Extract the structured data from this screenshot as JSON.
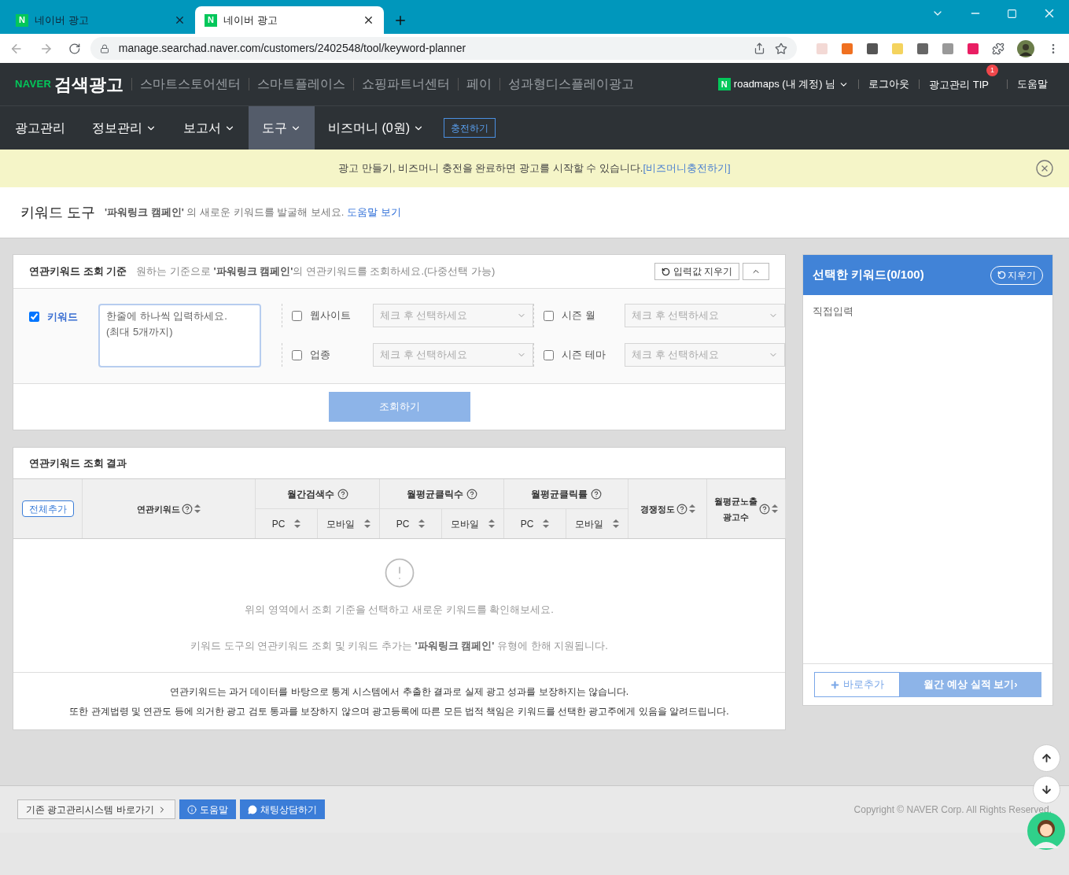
{
  "browser": {
    "tabs": [
      {
        "icon_letter": "N",
        "title": "네이버 광고",
        "selected": false
      },
      {
        "icon_letter": "N",
        "title": "네이버 광고",
        "selected": true
      }
    ],
    "url": "manage.searchad.naver.com/customers/2402548/tool/keyword-planner"
  },
  "header": {
    "logo": "NAVER",
    "product": "검색광고",
    "links": [
      "스마트스토어센터",
      "스마트플레이스",
      "쇼핑파트너센터",
      "페이",
      "성과형디스플레이광고"
    ],
    "user_badge": "N",
    "user": "roadmaps (내 계정) 님",
    "logout": "로그아웃",
    "tip": "광고관리 TIP",
    "tip_badge": "1",
    "help": "도움말"
  },
  "nav": {
    "items": [
      {
        "label": "광고관리",
        "dropdown": false,
        "selected": false
      },
      {
        "label": "정보관리",
        "dropdown": true,
        "selected": false
      },
      {
        "label": "보고서",
        "dropdown": true,
        "selected": false
      },
      {
        "label": "도구",
        "dropdown": true,
        "selected": true
      },
      {
        "label": "비즈머니 (0원)",
        "dropdown": true,
        "selected": false
      }
    ],
    "charge_button": "충전하기"
  },
  "notice": {
    "text": "광고 만들기, 비즈머니 충전을 완료하면 광고를 시작할 수 있습니다.",
    "link": "[비즈머니충전하기]"
  },
  "page_title": {
    "title": "키워드 도구",
    "description": "**'파워링크 캠페인'** 의 새로운 키워드를 발굴해 보세요.",
    "help_link": "도움말 보기"
  },
  "criteria": {
    "title": "연관키워드 조회 기준",
    "description": "원하는 기준으로 **'파워링크 캠페인'**의 연관키워드를 조회하세요.(다중선택 가능)",
    "clear_button": "입력값 지우기",
    "expanded": true,
    "keyword": {
      "label": "키워드",
      "checked": true,
      "placeholder": "한줄에 하나씩 입력하세요.\n(최대 5개까지)"
    },
    "filters": [
      {
        "label": "웹사이트",
        "checked": false,
        "placeholder": "체크 후 선택하세요"
      },
      {
        "label": "시즌 월",
        "checked": false,
        "placeholder": "체크 후 선택하세요"
      },
      {
        "label": "업종",
        "checked": false,
        "placeholder": "체크 후 선택하세요"
      },
      {
        "label": "시즌 테마",
        "checked": false,
        "placeholder": "체크 후 선택하세요"
      }
    ],
    "search_button": {
      "label": "조회하기",
      "disabled": true
    }
  },
  "results": {
    "title": "연관키워드 조회 결과",
    "add_all_button": "전체추가",
    "columns": [
      {
        "label": "연관키워드"
      },
      {
        "label": "월간검색수",
        "sub": [
          "PC",
          "모바일"
        ]
      },
      {
        "label": "월평균클릭수",
        "sub": [
          "PC",
          "모바일"
        ]
      },
      {
        "label": "월평균클릭률",
        "sub": [
          "PC",
          "모바일"
        ]
      },
      {
        "label": "경쟁정도"
      },
      {
        "label": "월평균노출\n광고수"
      }
    ],
    "empty_message": "위의 영역에서 조회 기준을 선택하고 새로운 키워드를 확인해보세요.",
    "note": "키워드 도구의 연관키워드 조회 및 키워드 추가는 **'파워링크 캠페인'** 유형에 한해 지원됩니다.",
    "disclaimer": [
      "연관키워드는 과거 데이터를 바탕으로 통계 시스템에서 추출한 결과로 실제 광고 성과를 보장하지는 않습니다.",
      "또한 관계법령 및 연관도 등에 의거한 광고 검토 통과를 보장하지 않으며 광고등록에 따른 모든 법적 책임은 키워드를 선택한 광고주에게 있음을 알려드립니다."
    ]
  },
  "selected_panel": {
    "title": "선택한 키워드(0/100)",
    "clear_button": "지우기",
    "direct_input": "직접입력",
    "add_button": "바로추가",
    "forecast_button": {
      "label": "월간 예상 실적 보기›",
      "disabled": true
    }
  },
  "footer": {
    "legacy_button": "기존 광고관리시스템 바로가기",
    "help_button": "도움말",
    "chat_button": "채팅상담하기",
    "copyright": "Copyright © NAVER Corp. All Rights Reserved."
  }
}
